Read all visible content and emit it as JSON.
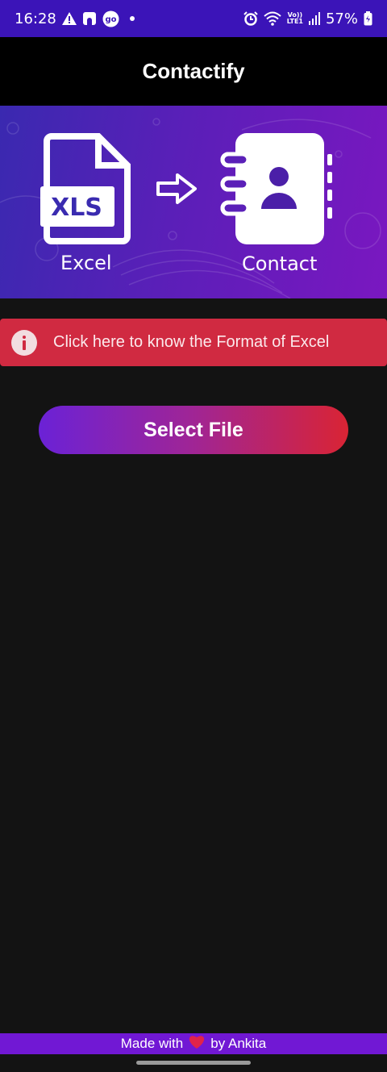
{
  "status_bar": {
    "time": "16:28",
    "left_icons": [
      "alert-triangle-icon",
      "bag-icon",
      "go-icon",
      "dot-icon"
    ],
    "go_badge": "go",
    "battery": "57%",
    "network_line1": "Vo))",
    "network_line2": "LTE1",
    "right_icons": [
      "alarm-icon",
      "wifi-icon",
      "signal-icon",
      "battery-icon"
    ]
  },
  "app_bar": {
    "title": "Contactify"
  },
  "banner": {
    "file_label": "XLS",
    "left_caption": "Excel",
    "right_caption": "Contact",
    "icons": [
      "xls-file-icon",
      "arrow-right-icon",
      "contact-book-icon"
    ]
  },
  "info": {
    "icon": "info-icon",
    "text": "Click here to know the Format of Excel",
    "color": "#d02a41"
  },
  "select_button": {
    "label": "Select File"
  },
  "footer": {
    "prefix": "Made with",
    "icon": "heart-icon",
    "suffix": "by Ankita",
    "color": "#7118d4"
  },
  "colors": {
    "status_bar": "#3b14b8",
    "background": "#131313",
    "button_start": "#6b22d6",
    "button_end": "#d92434"
  }
}
